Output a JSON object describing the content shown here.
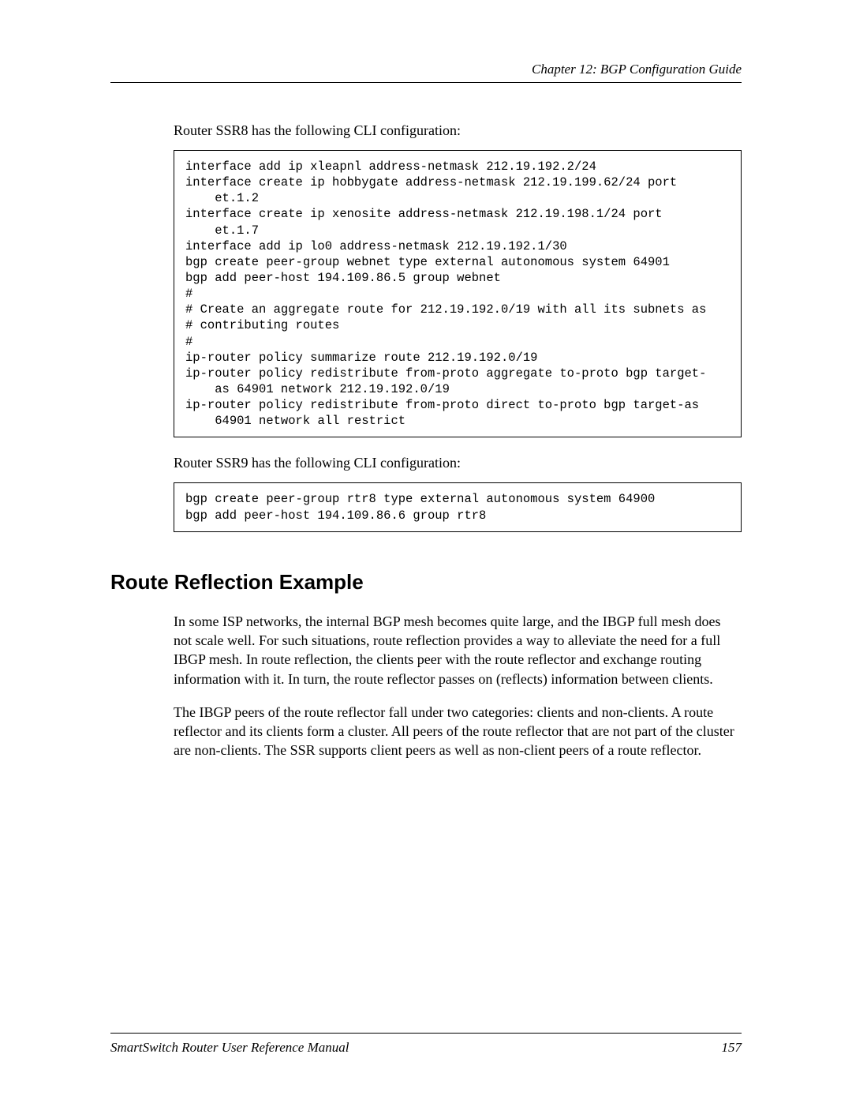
{
  "header": {
    "chapter": "Chapter 12: BGP Configuration Guide"
  },
  "intro1": "Router SSR8 has the following CLI configuration:",
  "code1": "interface add ip xleapnl address-netmask 212.19.192.2/24\ninterface create ip hobbygate address-netmask 212.19.199.62/24 port\n    et.1.2\ninterface create ip xenosite address-netmask 212.19.198.1/24 port\n    et.1.7\ninterface add ip lo0 address-netmask 212.19.192.1/30\nbgp create peer-group webnet type external autonomous system 64901\nbgp add peer-host 194.109.86.5 group webnet\n#\n# Create an aggregate route for 212.19.192.0/19 with all its subnets as\n# contributing routes\n#\nip-router policy summarize route 212.19.192.0/19\nip-router policy redistribute from-proto aggregate to-proto bgp target-\n    as 64901 network 212.19.192.0/19\nip-router policy redistribute from-proto direct to-proto bgp target-as\n    64901 network all restrict",
  "intro2": "Router SSR9 has the following CLI configuration:",
  "code2": "bgp create peer-group rtr8 type external autonomous system 64900\nbgp add peer-host 194.109.86.6 group rtr8",
  "section": {
    "title": "Route Reflection Example",
    "para1": "In some ISP networks, the internal BGP mesh becomes quite large, and the IBGP full mesh does not scale well. For such situations, route reflection provides a way to alleviate the need for a full IBGP mesh. In route reflection, the clients peer with the route reflector and exchange routing information with it. In turn, the route reflector passes on (reflects) information between clients.",
    "para2": "The IBGP peers of the route reflector fall under two categories: clients and non-clients. A route reflector and its clients form a cluster. All peers of the route reflector that are not part of the cluster are non-clients. The SSR supports client peers as well as non-client peers of a route reflector."
  },
  "footer": {
    "manual": "SmartSwitch Router User Reference Manual",
    "page": "157"
  }
}
